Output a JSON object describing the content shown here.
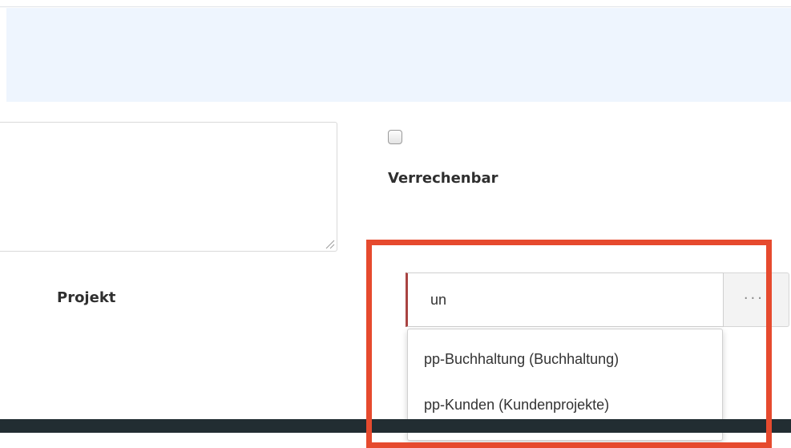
{
  "form": {
    "billable_label": "Verrechenbar",
    "project_label": "Projekt",
    "project_input_value": "un",
    "browse_button_label": "..."
  },
  "suggestions": [
    {
      "label": "pp-Buchhaltung (Buchhaltung)"
    },
    {
      "label": "pp-Kunden (Kundenprojekte)"
    }
  ],
  "colors": {
    "info_band": "#eef5fe",
    "highlight": "#e64a2e",
    "input_error_border": "#a94442",
    "footer": "#222d32"
  }
}
